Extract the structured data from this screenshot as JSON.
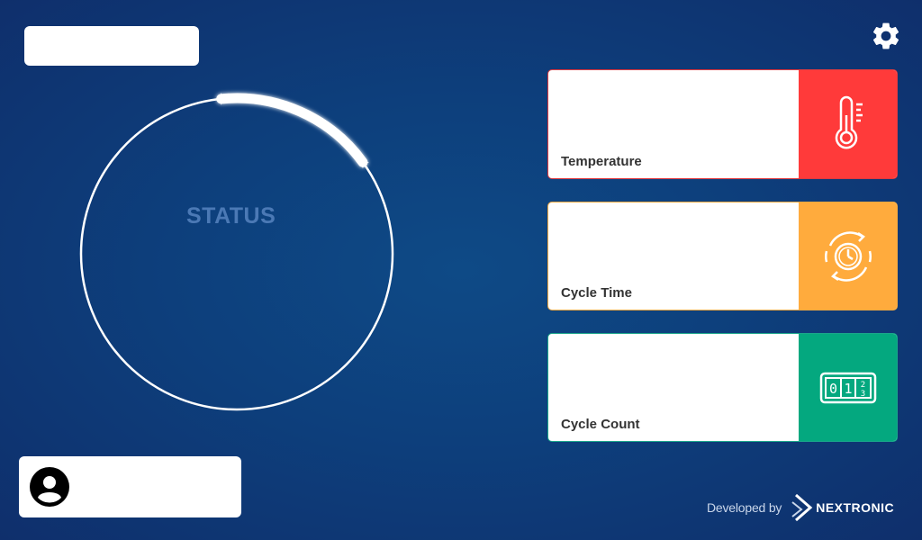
{
  "header": {
    "title_box_text": "",
    "settings_icon": "gear-icon"
  },
  "status": {
    "label": "STATUS",
    "progress": 0.15
  },
  "cards": [
    {
      "label": "Temperature",
      "value": "",
      "icon": "thermometer-icon",
      "color": "#ff3a3a"
    },
    {
      "label": "Cycle Time",
      "value": "",
      "icon": "clock-cycle-icon",
      "color": "#ffab3d"
    },
    {
      "label": "Cycle Count",
      "value": "",
      "icon": "counter-icon",
      "color": "#04a87f"
    }
  ],
  "user": {
    "name": "",
    "icon": "user-avatar-icon"
  },
  "footer": {
    "developed_by": "Developed by",
    "brand": "NEXTRONIC"
  },
  "colors": {
    "background": "#0e4a86",
    "status_text": "#4b79b5"
  }
}
